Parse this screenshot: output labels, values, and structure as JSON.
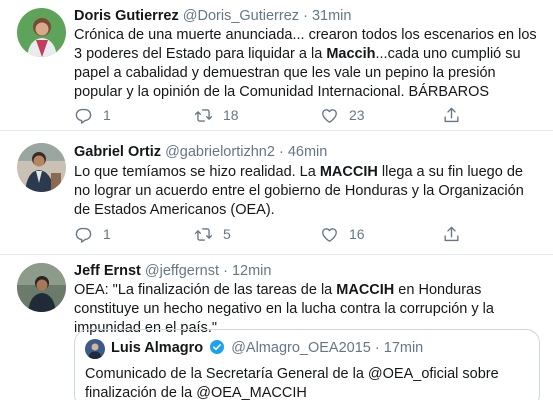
{
  "tweets": [
    {
      "name": "Doris Gutierrez",
      "handle": "@Doris_Gutierrez",
      "separator": "·",
      "time": "31min",
      "text_1": "Crónica de una muerte anunciada... crearon todos los escenarios en los 3 poderes del Estado para liquidar a la ",
      "bold_1": "Maccih",
      "text_2": "...cada uno cumplió su papel a cabalidad y demuestran que les vale un pepino la presión popular y la opinión de la Comunidad Internacional. BÁRBAROS",
      "replies": "1",
      "retweets": "18",
      "likes": "23"
    },
    {
      "name": "Gabriel Ortiz",
      "handle": "@gabrielortizhn2",
      "separator": "·",
      "time": "46min",
      "text_1": "Lo que temíamos se hizo realidad. La ",
      "bold_1": "MACCIH",
      "text_2": " llega a su fin luego de no lograr un acuerdo entre el gobierno de Honduras y la Organización de Estados Americanos (OEA).",
      "replies": "1",
      "retweets": "5",
      "likes": "16"
    },
    {
      "name": "Jeff Ernst",
      "handle": "@jeffgernst",
      "separator": "·",
      "time": "12min",
      "text_1": "OEA: \"La finalización de las tareas de la ",
      "bold_1": "MACCIH",
      "text_2": " en Honduras constituye un hecho negativo en la lucha contra la corrupción y la impunidad en el país.\"",
      "quote": {
        "name": "Luis Almagro",
        "handle": "@Almagro_OEA2015",
        "separator": "·",
        "time": "17min",
        "text": "Comunicado de la Secretaría General de la @OEA_oficial sobre finalización de la @OEA_MACCIH"
      }
    }
  ],
  "icons": {
    "reply": "reply-icon",
    "retweet": "retweet-icon",
    "like": "like-icon",
    "share": "share-icon",
    "verified": "verified-badge-icon"
  },
  "colors": {
    "text": "#14171a",
    "muted": "#657786",
    "border": "#e6ecf0",
    "verified": "#1da1f2"
  }
}
